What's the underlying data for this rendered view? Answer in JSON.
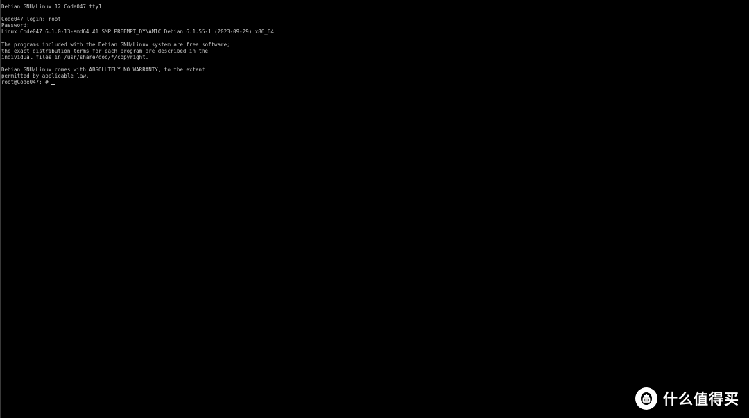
{
  "terminal": {
    "lines": [
      "Debian GNU/Linux 12 Code047 tty1",
      "",
      "Code047 login: root",
      "Password:",
      "Linux Code047 6.1.0-13-amd64 #1 SMP PREEMPT_DYNAMIC Debian 6.1.55-1 (2023-09-29) x86_64",
      "",
      "The programs included with the Debian GNU/Linux system are free software;",
      "the exact distribution terms for each program are described in the",
      "individual files in /usr/share/doc/*/copyright.",
      "",
      "Debian GNU/Linux comes with ABSOLUTELY NO WARRANTY, to the extent",
      "permitted by applicable law."
    ],
    "prompt": "root@Code047:~#"
  },
  "watermark": {
    "text": "什么值得买",
    "icon": "smzdm-logo-icon"
  },
  "colors": {
    "background": "#000000",
    "text": "#c8c8c8",
    "watermark": "#ffffff"
  }
}
